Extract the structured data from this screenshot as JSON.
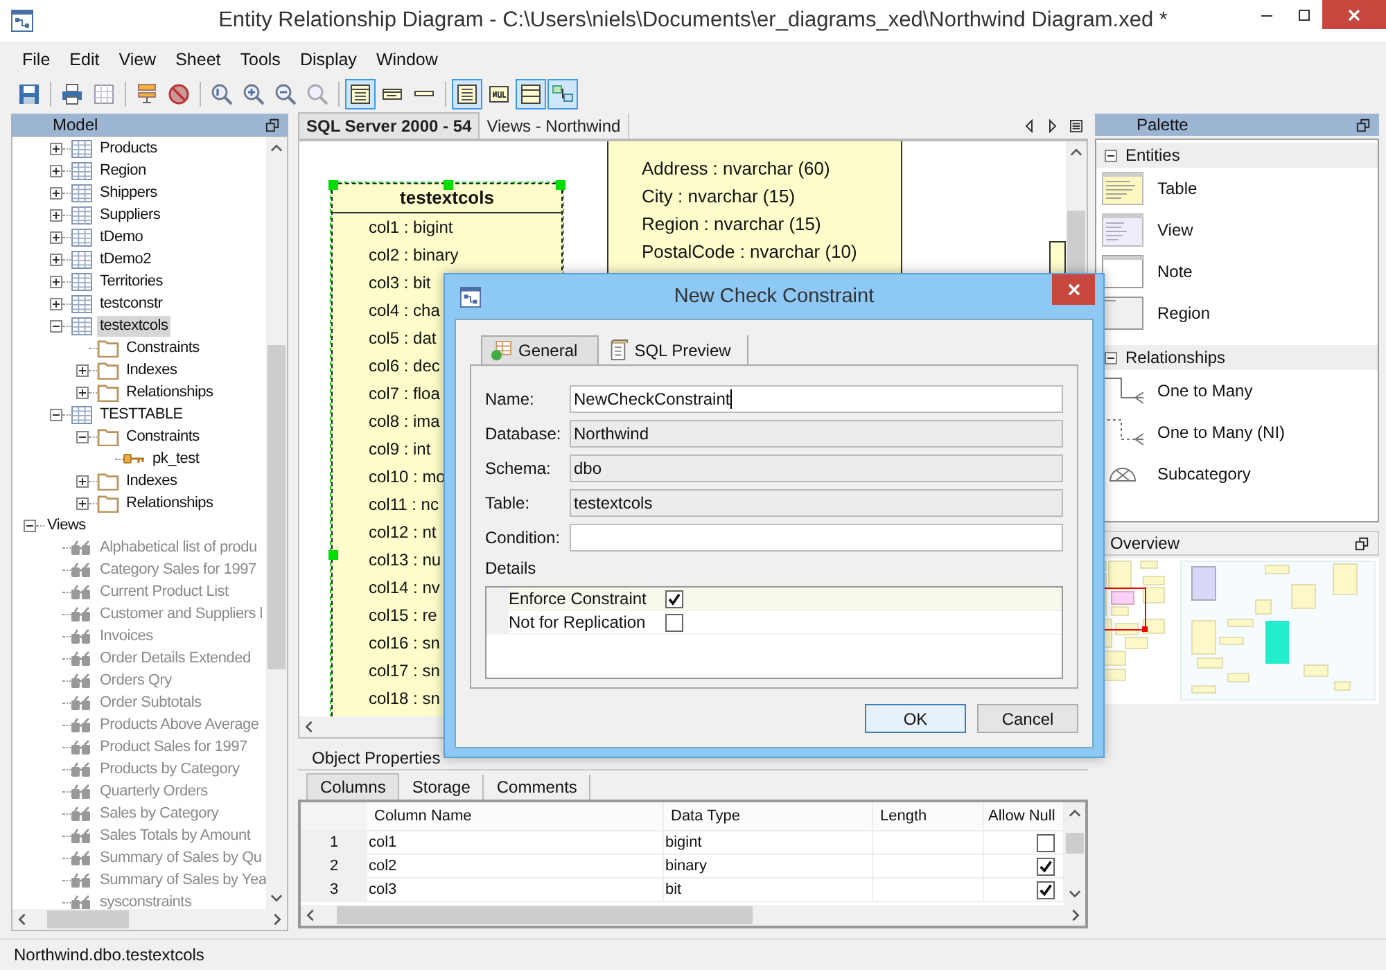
{
  "window": {
    "title": "Entity Relationship Diagram - C:\\Users\\niels\\Documents\\er_diagrams_xed\\Northwind Diagram.xed *"
  },
  "menu": [
    "File",
    "Edit",
    "View",
    "Sheet",
    "Tools",
    "Display",
    "Window"
  ],
  "display_toggles": [
    {
      "on": true
    },
    {
      "on": false
    },
    {
      "on": false
    },
    {
      "on": true
    },
    {
      "on": false
    },
    {
      "on": true
    },
    {
      "on": true
    }
  ],
  "model_panel": {
    "title": "Model",
    "scrolled_group": [
      {
        "label": "Products",
        "kind": "table",
        "expanded": false,
        "selected": false
      },
      {
        "label": "Region",
        "kind": "table",
        "expanded": false,
        "selected": false
      },
      {
        "label": "Shippers",
        "kind": "table",
        "expanded": false,
        "selected": false
      },
      {
        "label": "Suppliers",
        "kind": "table",
        "expanded": false,
        "selected": false
      },
      {
        "label": "tDemo",
        "kind": "table",
        "expanded": false,
        "selected": false
      },
      {
        "label": "tDemo2",
        "kind": "table",
        "expanded": false,
        "selected": false
      },
      {
        "label": "Territories",
        "kind": "table",
        "expanded": false,
        "selected": false
      },
      {
        "label": "testconstr",
        "kind": "table",
        "expanded": false,
        "selected": false
      },
      {
        "label": "testextcols",
        "kind": "table",
        "expanded": true,
        "selected": true,
        "children": [
          {
            "label": "Constraints",
            "kind": "folder",
            "selected": false
          },
          {
            "label": "Indexes",
            "kind": "folder",
            "expanded": false,
            "selected": false
          },
          {
            "label": "Relationships",
            "kind": "folder",
            "expanded": false,
            "selected": false
          }
        ]
      },
      {
        "label": "TESTTABLE",
        "kind": "table",
        "expanded": true,
        "selected": false,
        "children": [
          {
            "label": "Constraints",
            "kind": "folder",
            "expanded": true,
            "selected": false,
            "children": [
              {
                "label": "pk_test",
                "kind": "key",
                "selected": false
              }
            ]
          },
          {
            "label": "Indexes",
            "kind": "folder",
            "expanded": false,
            "selected": false
          },
          {
            "label": "Relationships",
            "kind": "folder",
            "expanded": false,
            "selected": false
          }
        ]
      }
    ],
    "nodes": [
      {
        "label": "Views",
        "expanded": true,
        "selected": false,
        "children": [
          {
            "label": "Alphabetical list of produ",
            "kind": "view",
            "selected": false
          },
          {
            "label": "Category Sales for 1997",
            "kind": "view",
            "selected": false
          },
          {
            "label": "Current Product List",
            "kind": "view",
            "selected": false
          },
          {
            "label": "Customer and Suppliers l",
            "kind": "view",
            "selected": false
          },
          {
            "label": "Invoices",
            "kind": "view",
            "selected": false
          },
          {
            "label": "Order Details Extended",
            "kind": "view",
            "selected": false
          },
          {
            "label": "Orders Qry",
            "kind": "view",
            "selected": false
          },
          {
            "label": "Order Subtotals",
            "kind": "view",
            "selected": false
          },
          {
            "label": "Products Above Average",
            "kind": "view",
            "selected": false
          },
          {
            "label": "Product Sales for 1997",
            "kind": "view",
            "selected": false
          },
          {
            "label": "Products by Category",
            "kind": "view",
            "selected": false
          },
          {
            "label": "Quarterly Orders",
            "kind": "view",
            "selected": false
          },
          {
            "label": "Sales by Category",
            "kind": "view",
            "selected": false
          },
          {
            "label": "Sales Totals by Amount",
            "kind": "view",
            "selected": false
          },
          {
            "label": "Summary of Sales by Qu",
            "kind": "view",
            "selected": false
          },
          {
            "label": "Summary of Sales by Yea",
            "kind": "view",
            "selected": false
          },
          {
            "label": "sysconstraints",
            "kind": "view",
            "selected": false
          }
        ]
      }
    ]
  },
  "editor_tabs": [
    {
      "label": "SQL Server 2000 - 54",
      "selected": true
    },
    {
      "label": "Views - Northwind",
      "selected": false
    }
  ],
  "diagram": {
    "tables": [
      {
        "title": "testextcols",
        "selected": true,
        "columns": [
          "col1 : bigint",
          "col2 : binary",
          "col3 : bit",
          "col4 : cha",
          "col5 : dat",
          "col6 : dec",
          "col7 : floa",
          "col8 : ima",
          "col9 : int",
          "col10 : mo",
          "col11 : nc",
          "col12 : nt",
          "col13 : nu",
          "col14 : nv",
          "col15 : re",
          "col16 : sn",
          "col17 : sn",
          "col18 : sn"
        ]
      },
      {
        "selected": false,
        "columns": [
          "Address : nvarchar (60)",
          "City : nvarchar (15)",
          "Region : nvarchar (15)",
          "PostalCode : nvarchar (10)"
        ]
      }
    ]
  },
  "object_properties": {
    "title": "Object Properties",
    "tabs": [
      {
        "label": "Columns",
        "selected": true
      },
      {
        "label": "Storage",
        "selected": false
      },
      {
        "label": "Comments",
        "selected": false
      }
    ],
    "columns": [
      "Column Name",
      "Data Type",
      "Length",
      "Allow Null"
    ],
    "rows": [
      {
        "number": "1",
        "name": "col1",
        "type": "bigint",
        "allow_nulls": false
      },
      {
        "number": "2",
        "name": "col2",
        "type": "binary",
        "allow_nulls": true
      },
      {
        "number": "3",
        "name": "col3",
        "type": "bit",
        "allow_nulls": true
      }
    ]
  },
  "palette": {
    "title": "Palette",
    "sections": [
      {
        "title": "Entities",
        "expanded": true,
        "items": [
          {
            "label": "Table",
            "kind": "table"
          },
          {
            "label": "View",
            "kind": "view"
          },
          {
            "label": "Note",
            "kind": "note"
          },
          {
            "label": "Region",
            "kind": "region"
          }
        ]
      },
      {
        "title": "Relationships",
        "expanded": true,
        "items": [
          {
            "label": "One to Many",
            "kind": "one-to-many"
          },
          {
            "label": "One to Many (NI)",
            "kind": "one-to-many-ni"
          },
          {
            "label": "Subcategory",
            "kind": "subcategory"
          }
        ]
      }
    ]
  },
  "overview": {
    "title": "Overview"
  },
  "dialog": {
    "title": "New Check Constraint",
    "tabs": [
      {
        "label": "General",
        "selected": true
      },
      {
        "label": "SQL Preview",
        "selected": false
      }
    ],
    "fields": [
      {
        "label": "Name:",
        "value": "NewCheckConstraint",
        "readonly": false,
        "focused": true
      },
      {
        "label": "Database:",
        "value": "Northwind",
        "readonly": true,
        "focused": false
      },
      {
        "label": "Schema:",
        "value": "dbo",
        "readonly": true,
        "focused": false
      },
      {
        "label": "Table:",
        "value": "testextcols",
        "readonly": true,
        "focused": false
      },
      {
        "label": "Condition:",
        "readonly": false,
        "focused": false
      }
    ],
    "details_label": "Details",
    "details": [
      {
        "label": "Enforce Constraint",
        "checked": true,
        "selected": true
      },
      {
        "label": "Not for Replication",
        "checked": false,
        "selected": false
      }
    ],
    "buttons": [
      {
        "label": "OK",
        "default": true
      },
      {
        "label": "Cancel",
        "default": false
      }
    ]
  },
  "status_bar": "Northwind.dbo.testextcols"
}
